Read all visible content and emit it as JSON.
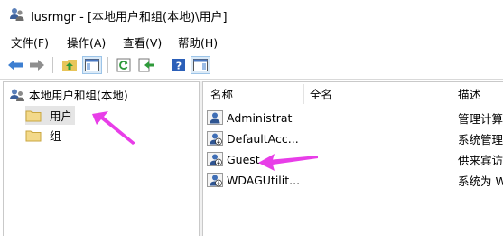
{
  "window": {
    "title": "lusrmgr - [本地用户和组(本地)\\用户]"
  },
  "menu": {
    "items": [
      "文件(F)",
      "操作(A)",
      "查看(V)",
      "帮助(H)"
    ]
  },
  "toolbar": {
    "buttons": [
      "back-icon",
      "forward-icon",
      "up-folder-icon",
      "show-hide-tree-icon",
      "refresh-icon",
      "export-list-icon",
      "help-icon",
      "action-pane-icon"
    ]
  },
  "tree": {
    "root_label": "本地用户和组(本地)",
    "nodes": [
      {
        "label": "用户",
        "selected": true
      },
      {
        "label": "组",
        "selected": false
      }
    ]
  },
  "list": {
    "columns": [
      "名称",
      "全名",
      "描述"
    ],
    "rows": [
      {
        "name": "Administrat",
        "full_name": "",
        "description": "管理计算"
      },
      {
        "name": "DefaultAcc...",
        "full_name": "",
        "description": "系统管理"
      },
      {
        "name": "Guest",
        "full_name": "",
        "description": "供来宾访"
      },
      {
        "name": "WDAGUtilit...",
        "full_name": "",
        "description": "系统为 W"
      }
    ]
  },
  "colors": {
    "annotation_arrow": "#e83ee8",
    "selection": "#e5e5e5",
    "pressed_button": "#dbeaf7"
  }
}
